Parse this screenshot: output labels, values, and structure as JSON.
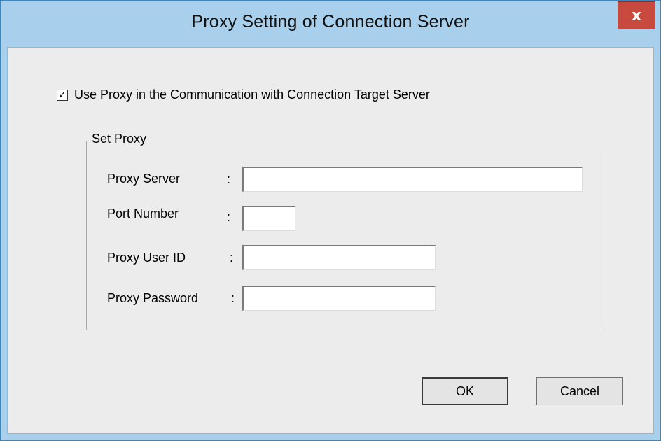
{
  "window": {
    "title": "Proxy Setting of Connection Server",
    "close_glyph": "x"
  },
  "use_proxy": {
    "checked": true,
    "label": "Use Proxy in the Communication with Connection Target Server"
  },
  "group": {
    "title": "Set Proxy",
    "fields": {
      "server": {
        "label": "Proxy Server",
        "value": ""
      },
      "port": {
        "label": "Port Number",
        "value": ""
      },
      "user_id": {
        "label": "Proxy User ID",
        "value": ""
      },
      "password": {
        "label": "Proxy Password",
        "value": ""
      }
    },
    "colon": ":"
  },
  "buttons": {
    "ok": "OK",
    "cancel": "Cancel"
  },
  "icons": {
    "checkbox": "check-icon",
    "close": "close-icon"
  },
  "colors": {
    "titlebar": "#a8d0ec",
    "close_button": "#c84a3e",
    "client": "#ececec"
  }
}
